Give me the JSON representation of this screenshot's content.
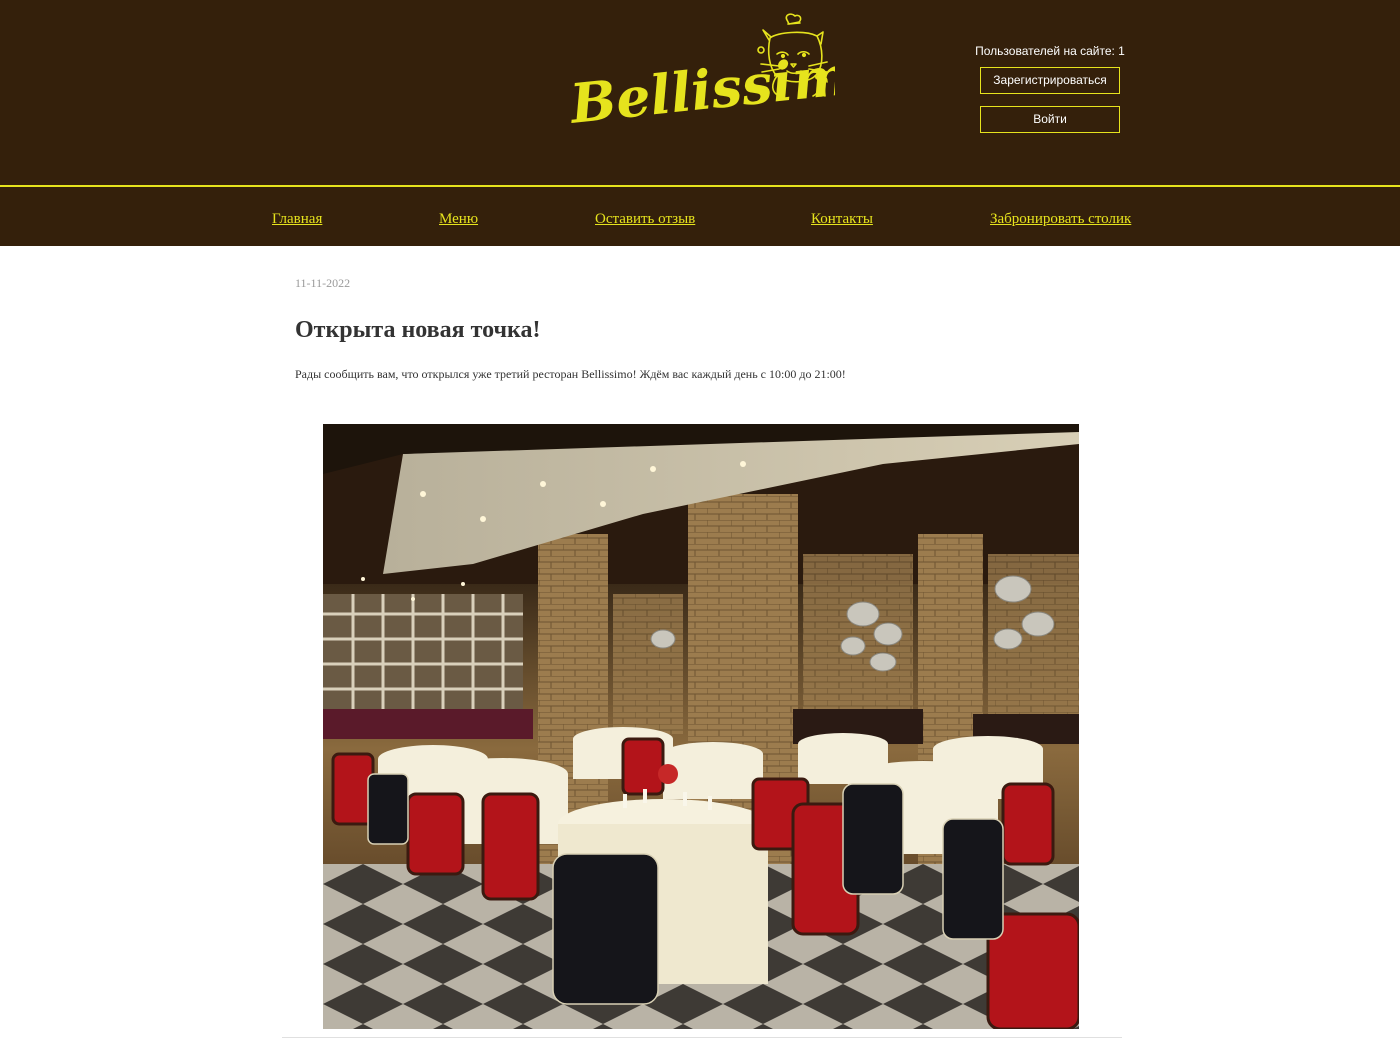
{
  "header": {
    "logo_text": "Bellissimo",
    "online_label": "Пользователей на сайте: ",
    "online_count": "1",
    "register_label": "Зарегистрироваться",
    "login_label": "Войти"
  },
  "nav": {
    "items": [
      {
        "label": "Главная"
      },
      {
        "label": "Меню"
      },
      {
        "label": "Оставить отзыв"
      },
      {
        "label": "Контакты"
      },
      {
        "label": "Забронировать столик"
      }
    ]
  },
  "post": {
    "date": "11-11-2022",
    "title": "Открыта новая точка!",
    "text": "Рады сообщить вам, что открылся уже третий ресторан Bellissimo! Ждём вас каждый день с 10:00 до 21:00!"
  },
  "colors": {
    "header_bg": "#34200b",
    "accent": "#e6e31d",
    "text": "#333333",
    "date": "#9a9a9a"
  }
}
